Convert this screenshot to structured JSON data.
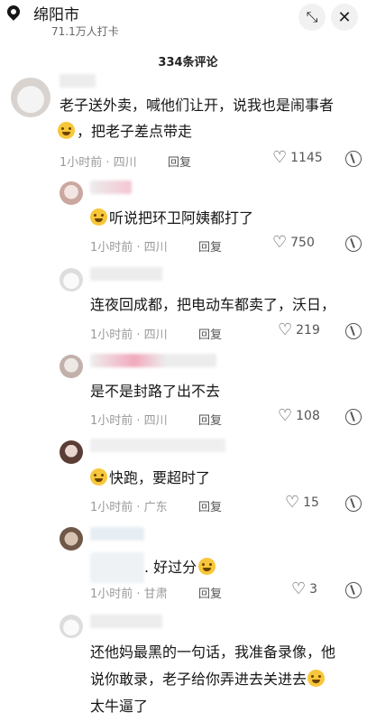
{
  "header": {
    "location": "绵阳市",
    "checkins": "71.1万人打卡",
    "collapse_icon": "compress-icon",
    "close_icon": "close-icon"
  },
  "comment_count": "334条评论",
  "comments": [
    {
      "text": "老子送外卖，喊他们让开，说我也是闹事者",
      "text2": "，把老子差点带走",
      "meta": "1小时前 · 四川",
      "reply": "回复",
      "likes": "1145"
    },
    {
      "text": "听说把环卫阿姨都打了",
      "meta": "1小时前 · 四川",
      "reply": "回复",
      "likes": "750"
    },
    {
      "text": "连夜回成都，把电动车都卖了，沃日，",
      "meta": "1小时前 · 四川",
      "reply": "回复",
      "likes": "219"
    },
    {
      "text": "是不是封路了出不去",
      "meta": "1小时前 · 四川",
      "reply": "回复",
      "likes": "108"
    },
    {
      "text": "快跑，要超时了",
      "meta": "1小时前 · 广东",
      "reply": "回复",
      "likes": "15"
    },
    {
      "text": ". 好过分",
      "meta": "1小时前 · 甘肃",
      "reply": "回复",
      "likes": "3"
    },
    {
      "text": "还他妈最黑的一句话，我准备录像，他",
      "text2": "说你敢录，老子给你弄进去关进去",
      "text3": "太牛逼了"
    }
  ],
  "colors": {
    "emoji": "#f8c63a",
    "meta": "#9a9a9a"
  }
}
